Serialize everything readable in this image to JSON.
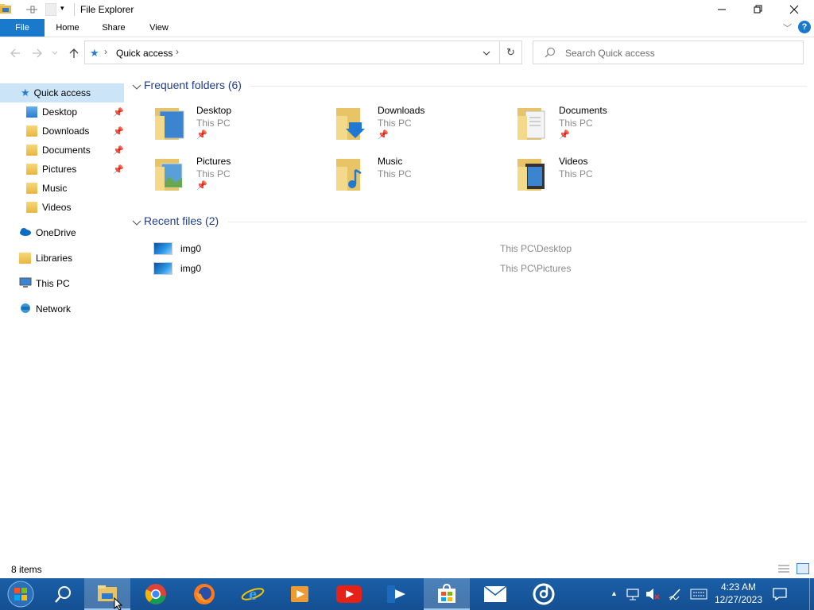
{
  "window": {
    "title": "File Explorer",
    "controls": [
      "minimize",
      "restore",
      "close"
    ]
  },
  "ribbon": {
    "tabs": [
      {
        "label": "File"
      },
      {
        "label": "Home"
      },
      {
        "label": "Share"
      },
      {
        "label": "View"
      }
    ]
  },
  "address": {
    "path": [
      "Quick access"
    ],
    "search_placeholder": "Search Quick access"
  },
  "nav": {
    "quick_access": "Quick access",
    "pinned": [
      {
        "label": "Desktop",
        "pinned": true
      },
      {
        "label": "Downloads",
        "pinned": true
      },
      {
        "label": "Documents",
        "pinned": true
      },
      {
        "label": "Pictures",
        "pinned": true
      },
      {
        "label": "Music",
        "pinned": false
      },
      {
        "label": "Videos",
        "pinned": false
      }
    ],
    "onedrive": "OneDrive",
    "libraries": "Libraries",
    "this_pc": "This PC",
    "network": "Network"
  },
  "content": {
    "frequent_header": "Frequent folders (6)",
    "folders": [
      {
        "name": "Desktop",
        "location": "This PC",
        "pinned": true
      },
      {
        "name": "Downloads",
        "location": "This PC",
        "pinned": true
      },
      {
        "name": "Documents",
        "location": "This PC",
        "pinned": true
      },
      {
        "name": "Pictures",
        "location": "This PC",
        "pinned": true
      },
      {
        "name": "Music",
        "location": "This PC",
        "pinned": false
      },
      {
        "name": "Videos",
        "location": "This PC",
        "pinned": false
      }
    ],
    "recent_header": "Recent files (2)",
    "recent": [
      {
        "name": "img0",
        "path": "This PC\\Desktop"
      },
      {
        "name": "img0",
        "path": "This PC\\Pictures"
      }
    ]
  },
  "status": {
    "items": "8 items"
  },
  "taskbar": {
    "time": "4:23 AM",
    "date": "12/27/2023"
  },
  "colors": {
    "accent": "#1979ca",
    "header_text": "#1e3e8c",
    "taskbar": "#1a5fa8"
  }
}
